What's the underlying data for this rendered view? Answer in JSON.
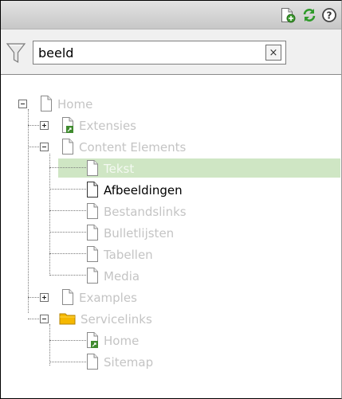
{
  "toolbar": {
    "icons": [
      "new-page-icon",
      "refresh-icon",
      "help-icon"
    ]
  },
  "filter": {
    "icon": "filter-icon",
    "value": "beeld",
    "clear_label": "×"
  },
  "tree": {
    "nodes": [
      {
        "label": "Home",
        "state": "dimmed",
        "expander": "minus"
      },
      {
        "label": "Extensies",
        "state": "dimmed",
        "expander": "plus"
      },
      {
        "label": "Content Elements",
        "state": "dimmed",
        "expander": "minus"
      },
      {
        "label": "Tekst",
        "state": "selected"
      },
      {
        "label": "Afbeeldingen",
        "state": "match"
      },
      {
        "label": "Bestandslinks",
        "state": "dimmed"
      },
      {
        "label": "Bulletlijsten",
        "state": "dimmed"
      },
      {
        "label": "Tabellen",
        "state": "dimmed"
      },
      {
        "label": "Media",
        "state": "dimmed"
      },
      {
        "label": "Examples",
        "state": "dimmed",
        "expander": "plus"
      },
      {
        "label": "Servicelinks",
        "state": "dimmed",
        "expander": "minus"
      },
      {
        "label": "Home",
        "state": "dimmed"
      },
      {
        "label": "Sitemap",
        "state": "dimmed"
      }
    ]
  },
  "colors": {
    "selection": "#cfe6c4",
    "dimmed_text": "#c4c4c4",
    "match_text": "#000000",
    "folder": "#f5b800"
  }
}
